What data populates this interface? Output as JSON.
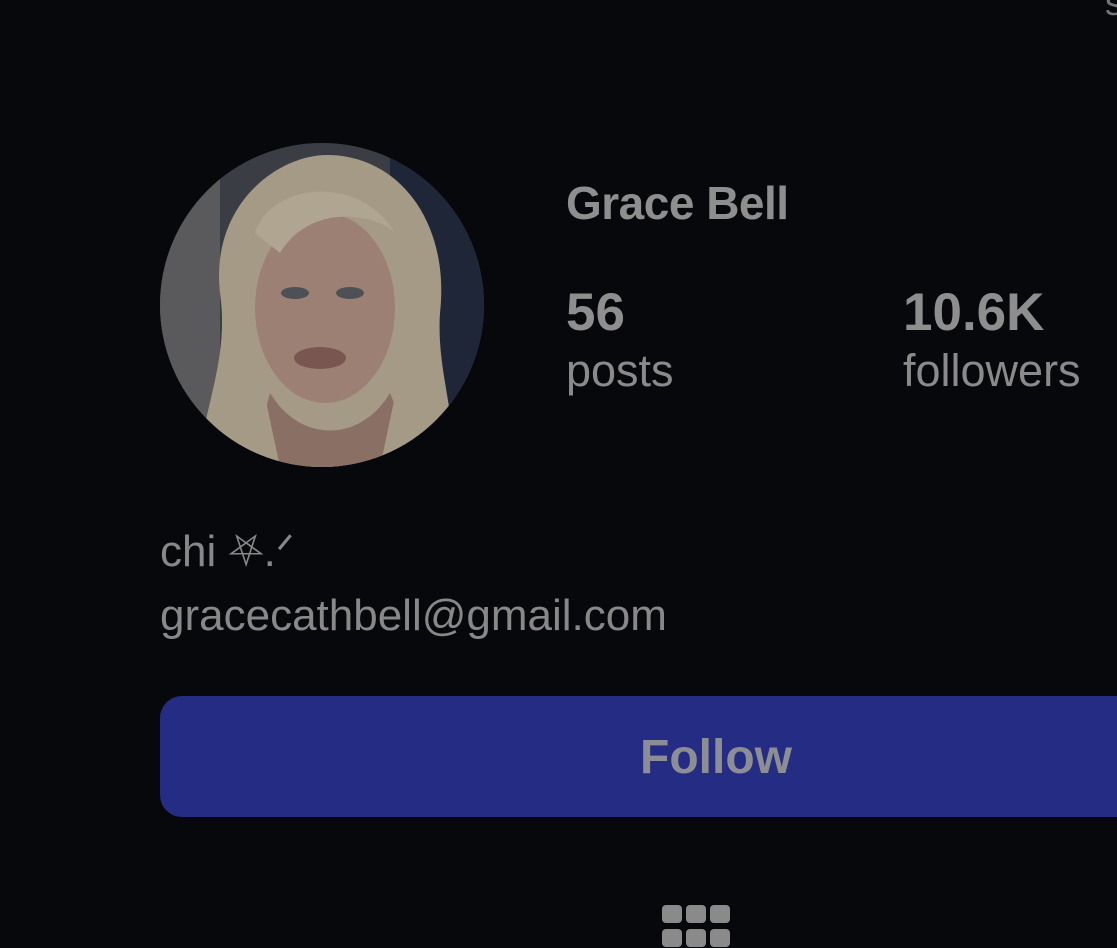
{
  "profile": {
    "name": "Grace Bell",
    "avatar_alt": "profile photo"
  },
  "stats": {
    "posts": {
      "value": "56",
      "label": "posts"
    },
    "followers": {
      "value": "10.6K",
      "label": "followers"
    }
  },
  "bio": {
    "line1": "chi ⛧.ᐟ",
    "line2": "gracecathbell@gmail.com"
  },
  "actions": {
    "follow_label": "Follow"
  },
  "tabs": {
    "grid_icon": "grid-icon"
  },
  "colors": {
    "background": "#07080b",
    "follow_button": "#252c83",
    "text": "#8e8e8e"
  }
}
